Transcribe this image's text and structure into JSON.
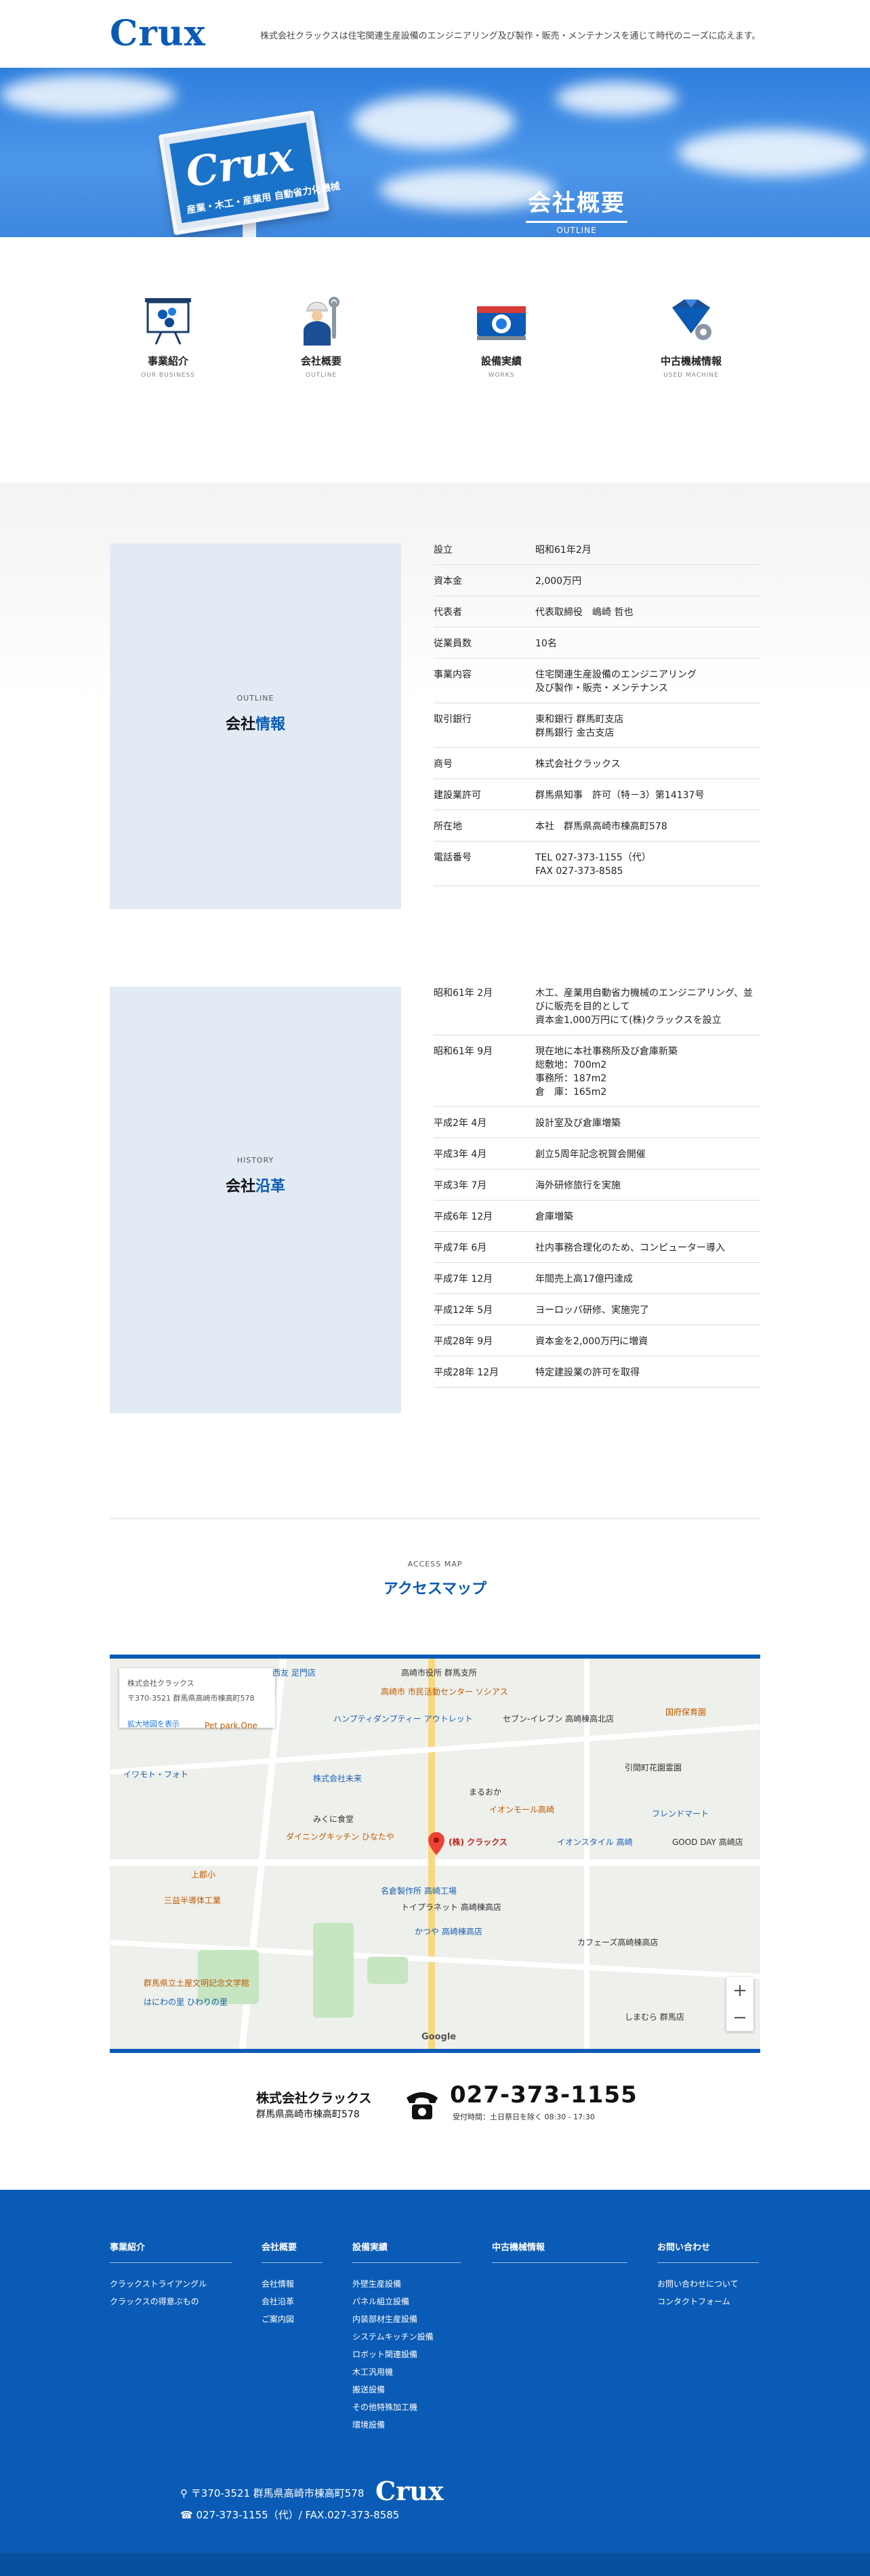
{
  "header": {
    "logo": "Crux",
    "tagline": "株式会社クラックスは住宅関連生産設備のエンジニアリング及び製作・販売・メンテナンスを通じて時代のニーズに応えます。"
  },
  "hero": {
    "sign_text": "Crux",
    "sign_sub": "産業・木工・産業用 自動省力化機械",
    "title": "会社概要",
    "subtitle": "OUTLINE"
  },
  "nav": [
    {
      "label": "事業紹介",
      "sub": "OUR BUSINESS"
    },
    {
      "label": "会社概要",
      "sub": "OUTLINE"
    },
    {
      "label": "設備実績",
      "sub": "WORKS"
    },
    {
      "label": "中古機械情報",
      "sub": "USED MACHINE"
    }
  ],
  "company": {
    "heading_en": "OUTLINE",
    "heading_a": "会社",
    "heading_b": "情報",
    "rows": [
      {
        "k": "設立",
        "v": "昭和61年2月"
      },
      {
        "k": "資本金",
        "v": "2,000万円"
      },
      {
        "k": "代表者",
        "v": "代表取締役　嶋崎 哲也"
      },
      {
        "k": "従業員数",
        "v": "10名"
      },
      {
        "k": "事業内容",
        "v": "住宅関連生産設備のエンジニアリング\n及び製作・販売・メンテナンス"
      },
      {
        "k": "取引銀行",
        "v": "東和銀行 群馬町支店\n群馬銀行 金古支店"
      },
      {
        "k": "商号",
        "v": "株式会社クラックス"
      },
      {
        "k": "建設業許可",
        "v": "群馬県知事　許可（特－3）第14137号"
      },
      {
        "k": "所在地",
        "v": "本社　群馬県高崎市棟高町578"
      },
      {
        "k": "電話番号",
        "v": "TEL 027-373-1155（代）\nFAX 027-373-8585"
      }
    ]
  },
  "history": {
    "heading_en": "HISTORY",
    "heading_a": "会社",
    "heading_b": "沿革",
    "rows": [
      {
        "k": "昭和61年 2月",
        "v": "木工、産業用自動省力機械のエンジニアリング、並びに販売を目的として\n資本金1,000万円にて(株)クラックスを設立"
      },
      {
        "k": "昭和61年 9月",
        "v": "現在地に本社事務所及び倉庫新築\n総敷地：700m2\n事務所：187m2\n倉　庫：165m2"
      },
      {
        "k": "平成2年 4月",
        "v": "設計室及び倉庫増築"
      },
      {
        "k": "平成3年 4月",
        "v": "創立5周年記念祝賀会開催"
      },
      {
        "k": "平成3年 7月",
        "v": "海外研修旅行を実施"
      },
      {
        "k": "平成6年 12月",
        "v": "倉庫増築"
      },
      {
        "k": "平成7年 6月",
        "v": "社内事務合理化のため、コンピューター導入"
      },
      {
        "k": "平成7年 12月",
        "v": "年間売上高17億円達成"
      },
      {
        "k": "平成12年 5月",
        "v": "ヨーロッパ研修、実施完了"
      },
      {
        "k": "平成28年 9月",
        "v": "資本金を2,000万円に増資"
      },
      {
        "k": "平成28年 12月",
        "v": "特定建設業の許可を取得"
      }
    ]
  },
  "access": {
    "heading_en": "ACCESS MAP",
    "heading_a": "アクセス",
    "heading_b": "マップ",
    "map": {
      "card_title": "株式会社クラックス",
      "card_addr": "〒370-3521 群馬県高崎市棟高町578",
      "card_link": "拡大地図を表示",
      "pin_label": "(株) クラックス",
      "labels": [
        "西友 足門店",
        "高崎市役所 群馬支所",
        "高崎市 市民活動センター ソシアス",
        "ハンプティダンプティー アウトレット",
        "セブン-イレブン 高崎棟高北店",
        "Pet park.One",
        "株式会社未来",
        "まるおか",
        "イオンモール高崎",
        "イワモト・フォト",
        "みくに食堂",
        "ダイニングキッチン ひなたや",
        "イオンスタイル 高崎",
        "引間町花園霊園",
        "上郡小",
        "名倉製作所 高崎工場",
        "トイプラネット 高崎棟高店",
        "三益半導体工業",
        "かつや 高崎棟高店",
        "カフェーズ高崎棟高店",
        "群馬県立土屋文明記念文学館",
        "はにわの里 ひわりの里",
        "しまむら 群馬店",
        "国府保育園",
        "フレンドマート",
        "GOOD DAY 高崎店"
      ],
      "google": "Google",
      "zoom_in": "+",
      "zoom_out": "−"
    },
    "company_name": "株式会社クラックス",
    "company_addr": "群馬県高崎市棟高町578",
    "phone": "027-373-1155",
    "hours": "受付時間：土日祭日を除く 08:30 - 17:30"
  },
  "footer": {
    "cols": [
      {
        "title": "事業紹介",
        "items": [
          "クラックストライアングル",
          "クラックスの得意ぶもの"
        ]
      },
      {
        "title": "会社概要",
        "items": [
          "会社情報",
          "会社沿革",
          "ご案内図"
        ]
      },
      {
        "title": "設備実績",
        "items": [
          "外壁生産設備",
          "パネル組立設備",
          "内装部材生産設備",
          "システムキッチン設備",
          "ロボット関連設備",
          "木工汎用機",
          "搬送設備",
          "その他特殊加工機",
          "環境設備"
        ]
      },
      {
        "title": "中古機械情報",
        "items": []
      },
      {
        "title": "お問い合わせ",
        "items": [
          "お問い合わせについて",
          "コンタクトフォーム"
        ]
      }
    ],
    "address": "〒370-3521 群馬県高崎市棟高町578",
    "tel": "027-373-1155（代）/ FAX.027-373-8585",
    "logo": "Crux"
  },
  "colors": {
    "brand": "#0a5bb5",
    "side_box": "#e2ebf4"
  }
}
